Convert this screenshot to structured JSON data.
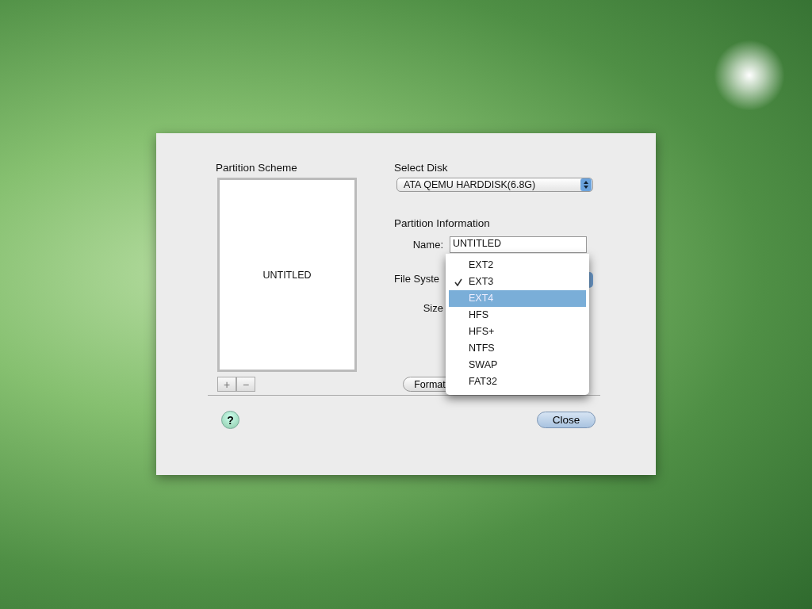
{
  "partition_scheme": {
    "label": "Partition Scheme",
    "partitions": [
      "UNTITLED"
    ],
    "add_button": "+",
    "remove_button": "−"
  },
  "select_disk": {
    "label": "Select Disk",
    "value": "ATA QEMU HARDDISK(6.8G)"
  },
  "partition_information": {
    "label": "Partition Information",
    "name_label": "Name:",
    "name_value": "UNTITLED",
    "file_system_label": "File Syste",
    "size_label": "Size"
  },
  "buttons": [
    "Format"
  ],
  "file_system_menu": [
    {
      "label": "EXT2",
      "checked": false,
      "selected": false
    },
    {
      "label": "EXT3",
      "checked": true,
      "selected": false
    },
    {
      "label": "EXT4",
      "checked": false,
      "selected": true
    },
    {
      "label": "HFS",
      "checked": false,
      "selected": false
    },
    {
      "label": "HFS+",
      "checked": false,
      "selected": false
    },
    {
      "label": "NTFS",
      "checked": false,
      "selected": false
    },
    {
      "label": "SWAP",
      "checked": false,
      "selected": false
    },
    {
      "label": "FAT32",
      "checked": false,
      "selected": false
    }
  ],
  "help_button": "?",
  "close_button": "Close"
}
